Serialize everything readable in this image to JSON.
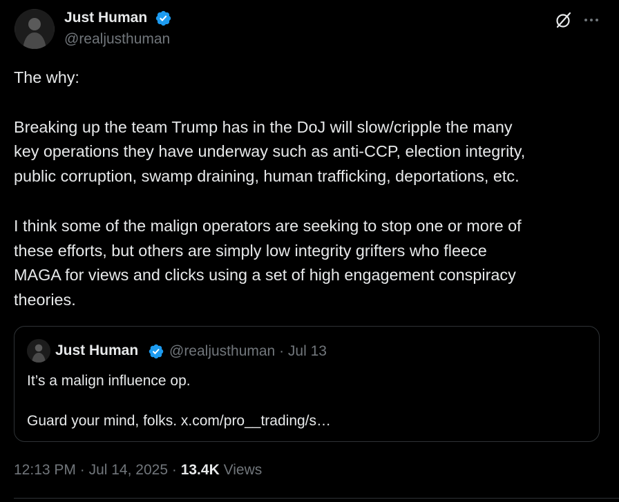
{
  "author": {
    "name": "Just Human",
    "handle": "@realjusthuman",
    "verified": true,
    "avatar_icon": "avatar-image"
  },
  "header_icons": {
    "grok": "grok-icon",
    "more": "more-options-icon"
  },
  "tweet": {
    "paragraphs": [
      [
        "The why:"
      ],
      [
        "Breaking up the team Trump has in the DoJ will slow/cripple the many",
        "key operations they have underway such as anti-CCP, election integrity,",
        "public corruption, swamp draining, human trafficking, deportations, etc."
      ],
      [
        "I think some of the malign operators are seeking to stop one or more of",
        "these efforts, but others are simply low integrity grifters who fleece",
        "MAGA for views and clicks using a set of high engagement conspiracy",
        "theories."
      ]
    ]
  },
  "quote": {
    "name": "Just Human",
    "handle": "@realjusthuman",
    "separator": "·",
    "date": "Jul 13",
    "line1": "It’s a malign influence op.",
    "line2": "Guard your mind, folks. x.com/pro__trading/s…"
  },
  "footer": {
    "time": "12:13 PM",
    "separator": "·",
    "date": "Jul 14, 2025",
    "views_count": "13.4K",
    "views_label": "Views"
  },
  "colors": {
    "background": "#000000",
    "text": "#e7e9ea",
    "muted": "#71767b",
    "verified_blue": "#1d9bf0",
    "border": "#2f3336"
  }
}
